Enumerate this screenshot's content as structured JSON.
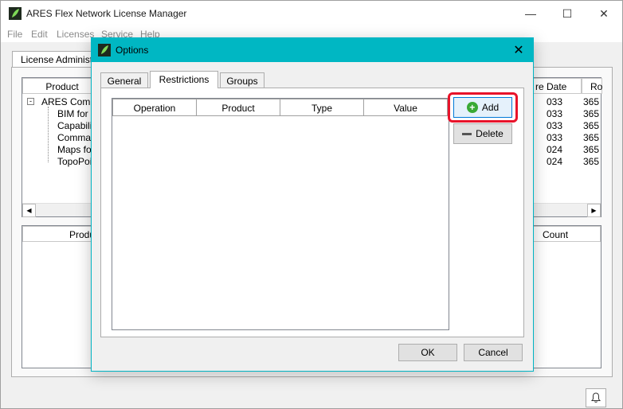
{
  "window": {
    "title": "ARES Flex Network License Manager",
    "minimize": "—",
    "maximize": "☐",
    "close": "✕"
  },
  "menu": [
    "File",
    "Edit",
    "Licenses",
    "Service",
    "Help"
  ],
  "background": {
    "tab_label": "License Administ",
    "top_list": {
      "header_product": "Product",
      "header_date": "re Date",
      "header_right": "Ro",
      "tree_root": "ARES Comm",
      "tree_items": [
        "BIM for",
        "Capabili",
        "Comma.",
        "Maps fo",
        "TopoPoi"
      ],
      "dates": [
        "033",
        "033",
        "033",
        "033",
        "024",
        "024"
      ],
      "values": [
        "365",
        "365",
        "365",
        "365",
        "365",
        "365"
      ]
    },
    "bottom_list": {
      "header_product": "Produ",
      "header_count": "Count"
    }
  },
  "dialog": {
    "title": "Options",
    "close": "✕",
    "tabs": [
      "General",
      "Restrictions",
      "Groups"
    ],
    "active_tab": "Restrictions",
    "columns": [
      "Operation",
      "Product",
      "Type",
      "Value"
    ],
    "add_label": "Add",
    "delete_label": "Delete",
    "ok_label": "OK",
    "cancel_label": "Cancel"
  },
  "colors": {
    "dialog_title_bar": "#00b7c3",
    "highlight": "#e8132a",
    "add_icon": "#3aa935"
  }
}
